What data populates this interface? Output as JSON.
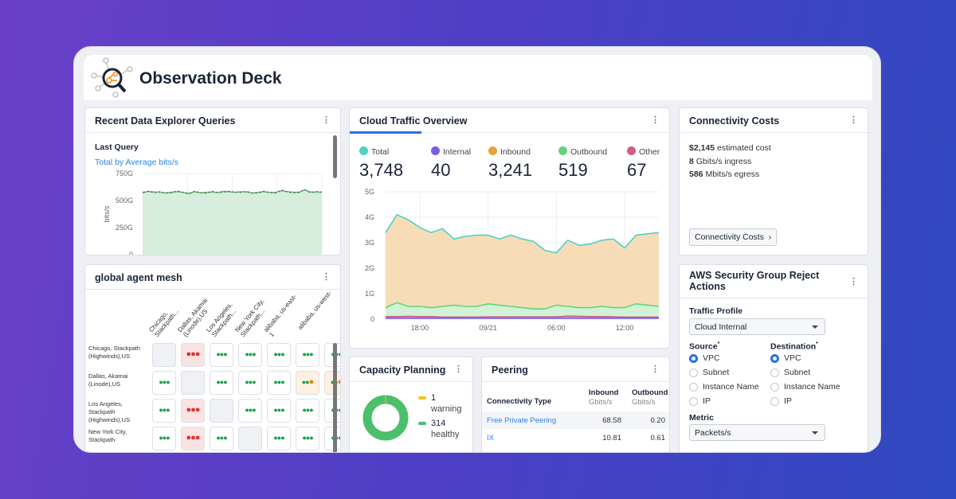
{
  "app": {
    "title": "Observation Deck"
  },
  "panels": {
    "queries": {
      "title": "Recent Data Explorer Queries",
      "subtitle": "Last Query",
      "query_link": "Total by Average bits/s"
    },
    "mesh": {
      "title": "global agent mesh",
      "columns": [
        "Chicago, Stackpath...",
        "Dallas, Akamai (Linode),US",
        "Los Angeles, Stackpath...",
        "New York City, Stackpath...",
        "alibaba, us-east-1",
        "alibaba, us-west-"
      ],
      "rows": [
        {
          "label": "Chicago, Stackpath (Highwinds),US",
          "cells": [
            "self",
            "red",
            "green",
            "green",
            "green",
            "green",
            "green"
          ]
        },
        {
          "label": "Dallas, Akamai (Linode),US",
          "cells": [
            "green",
            "self",
            "green",
            "green",
            "green",
            "warn",
            "warn"
          ]
        },
        {
          "label": "Los Angeles, Stackpath (Highwinds),US",
          "cells": [
            "green",
            "red",
            "self",
            "green",
            "green",
            "green",
            "green"
          ]
        },
        {
          "label": "New York City, Stackpath",
          "cells": [
            "green",
            "red",
            "green",
            "self",
            "green",
            "green",
            "green"
          ]
        }
      ]
    },
    "traffic": {
      "title": "Cloud Traffic Overview",
      "legend": [
        {
          "name": "Total",
          "value": "3,748",
          "color": "#4fd1c5"
        },
        {
          "name": "Internal",
          "value": "40",
          "color": "#7c5ce6"
        },
        {
          "name": "Inbound",
          "value": "3,241",
          "color": "#eaa23c"
        },
        {
          "name": "Outbound",
          "value": "519",
          "color": "#63d47a"
        },
        {
          "name": "Other",
          "value": "67",
          "color": "#d05c8a"
        }
      ]
    },
    "capacity": {
      "title": "Capacity Planning",
      "warning_count": "1",
      "warning_label": "warning",
      "healthy_count": "314",
      "healthy_label": "healthy",
      "warning_color": "#f5c518",
      "healthy_color": "#4cbf6b"
    },
    "peering": {
      "title": "Peering",
      "headers": [
        "Connectivity Type",
        "Inbound",
        "Outbound"
      ],
      "units": [
        "",
        "Gbits/s",
        "Gbits/s"
      ],
      "rows": [
        {
          "type": "Free Private Peering",
          "inbound": "68.58",
          "outbound": "0.20"
        },
        {
          "type": "IX",
          "inbound": "10.81",
          "outbound": "0.61"
        }
      ]
    },
    "costs": {
      "title": "Connectivity Costs",
      "lines": [
        {
          "value": "$2,145",
          "label": "estimated cost"
        },
        {
          "value": "8",
          "label": "Gbits/s ingress"
        },
        {
          "value": "586",
          "label": "Mbits/s egress"
        }
      ],
      "button": "Connectivity Costs"
    },
    "aws": {
      "title": "AWS Security Group Reject Actions",
      "traffic_profile_label": "Traffic Profile",
      "traffic_profile_value": "Cloud Internal",
      "source_label": "Source",
      "destination_label": "Destination",
      "options": [
        "VPC",
        "Subnet",
        "Instance Name",
        "IP"
      ],
      "source_selected": "VPC",
      "destination_selected": "VPC",
      "metric_label": "Metric",
      "metric_value": "Packets/s"
    }
  },
  "chart_data": [
    {
      "type": "area",
      "ylabel": "bits/s",
      "yticks": [
        "0",
        "250G",
        "500G",
        "750G"
      ],
      "ylim": [
        0,
        750
      ],
      "unit": "G",
      "series": [
        {
          "values": [
            570,
            585,
            580,
            575,
            570,
            578,
            582,
            575,
            568,
            580,
            572,
            576,
            578,
            574,
            586,
            580,
            576,
            583,
            578,
            570,
            577,
            581,
            574,
            576,
            590,
            582,
            578,
            572,
            600,
            580,
            576,
            578
          ]
        }
      ],
      "series_style": [
        {
          "fill": "#d6eedb",
          "line": "#6cc77f"
        },
        {
          "dash": true,
          "line": "#555"
        }
      ]
    },
    {
      "type": "area",
      "stacked": true,
      "ylim": [
        0,
        5
      ],
      "yticks": [
        "0",
        "1G",
        "2G",
        "3G",
        "4G",
        "5G"
      ],
      "xticks": [
        "18:00",
        "09/21",
        "06:00",
        "12:00"
      ],
      "xtick_index": [
        3,
        9,
        15,
        21
      ],
      "series": [
        {
          "name": "Total",
          "values": [
            3.4,
            4.1,
            3.9,
            3.6,
            3.4,
            3.55,
            3.15,
            3.25,
            3.3,
            3.3,
            3.15,
            3.3,
            3.15,
            3.05,
            2.7,
            2.6,
            3.1,
            2.9,
            2.95,
            3.1,
            3.15,
            2.8,
            3.3,
            3.35,
            3.4
          ]
        },
        {
          "name": "Outbound",
          "values": [
            0.45,
            0.65,
            0.5,
            0.5,
            0.45,
            0.5,
            0.55,
            0.5,
            0.5,
            0.6,
            0.55,
            0.5,
            0.45,
            0.4,
            0.4,
            0.55,
            0.5,
            0.45,
            0.45,
            0.5,
            0.45,
            0.45,
            0.6,
            0.55,
            0.5
          ]
        },
        {
          "name": "Other",
          "values": [
            0.1,
            0.1,
            0.11,
            0.1,
            0.1,
            0.08,
            0.08,
            0.08,
            0.08,
            0.09,
            0.09,
            0.09,
            0.09,
            0.09,
            0.09,
            0.09,
            0.12,
            0.11,
            0.1,
            0.1,
            0.09,
            0.08,
            0.08,
            0.08,
            0.08
          ]
        },
        {
          "name": "Internal",
          "values": [
            0.04,
            0.04,
            0.04,
            0.04,
            0.04,
            0.04,
            0.04,
            0.04,
            0.04,
            0.04,
            0.04,
            0.04,
            0.04,
            0.04,
            0.04,
            0.04,
            0.04,
            0.04,
            0.04,
            0.04,
            0.04,
            0.04,
            0.04,
            0.04,
            0.04
          ]
        }
      ]
    }
  ]
}
